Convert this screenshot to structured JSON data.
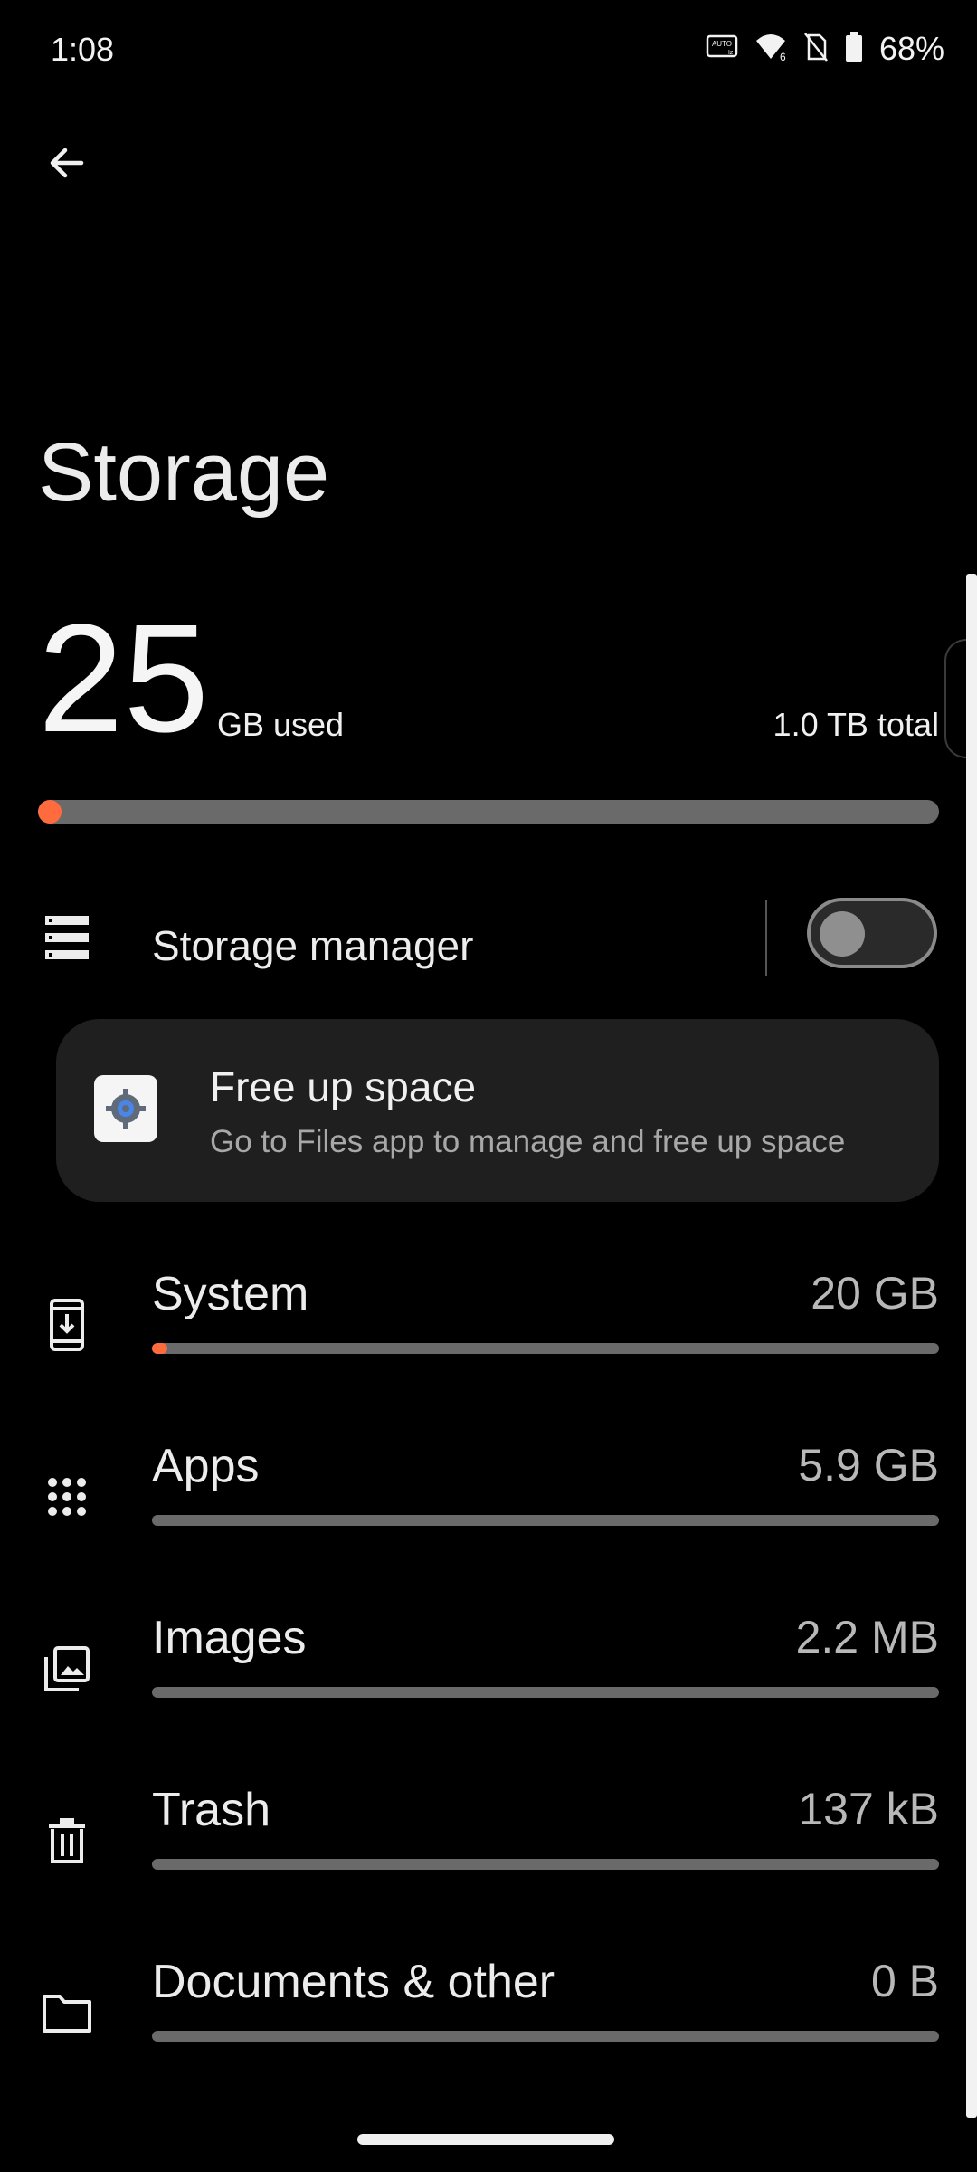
{
  "status_bar": {
    "time": "1:08",
    "battery_percent": "68%",
    "icons": [
      "auto-hz-icon",
      "wifi-6-icon",
      "no-sim-icon",
      "battery-icon"
    ]
  },
  "header": {
    "back_icon": "arrow-back-icon"
  },
  "page": {
    "title": "Storage"
  },
  "summary": {
    "used_value": "25",
    "used_unit": "GB used",
    "total": "1.0 TB total",
    "used_fraction": 0.025
  },
  "storage_manager": {
    "label": "Storage manager",
    "enabled": false,
    "icon": "list-icon"
  },
  "free_up_card": {
    "title": "Free up space",
    "subtitle": "Go to Files app to manage and free up space",
    "icon": "files-gear-icon"
  },
  "categories": [
    {
      "label": "System",
      "value": "20 GB",
      "icon": "system-update-icon",
      "fraction": 0.02
    },
    {
      "label": "Apps",
      "value": "5.9 GB",
      "icon": "apps-grid-icon",
      "fraction": 0
    },
    {
      "label": "Images",
      "value": "2.2 MB",
      "icon": "images-icon",
      "fraction": 0
    },
    {
      "label": "Trash",
      "value": "137 kB",
      "icon": "trash-icon",
      "fraction": 0
    },
    {
      "label": "Documents & other",
      "value": "0 B",
      "icon": "folder-icon",
      "fraction": 0
    }
  ],
  "colors": {
    "accent": "#ff6b3d",
    "track": "#6a6a6a",
    "background": "#000000",
    "card": "#1f1f1f"
  }
}
